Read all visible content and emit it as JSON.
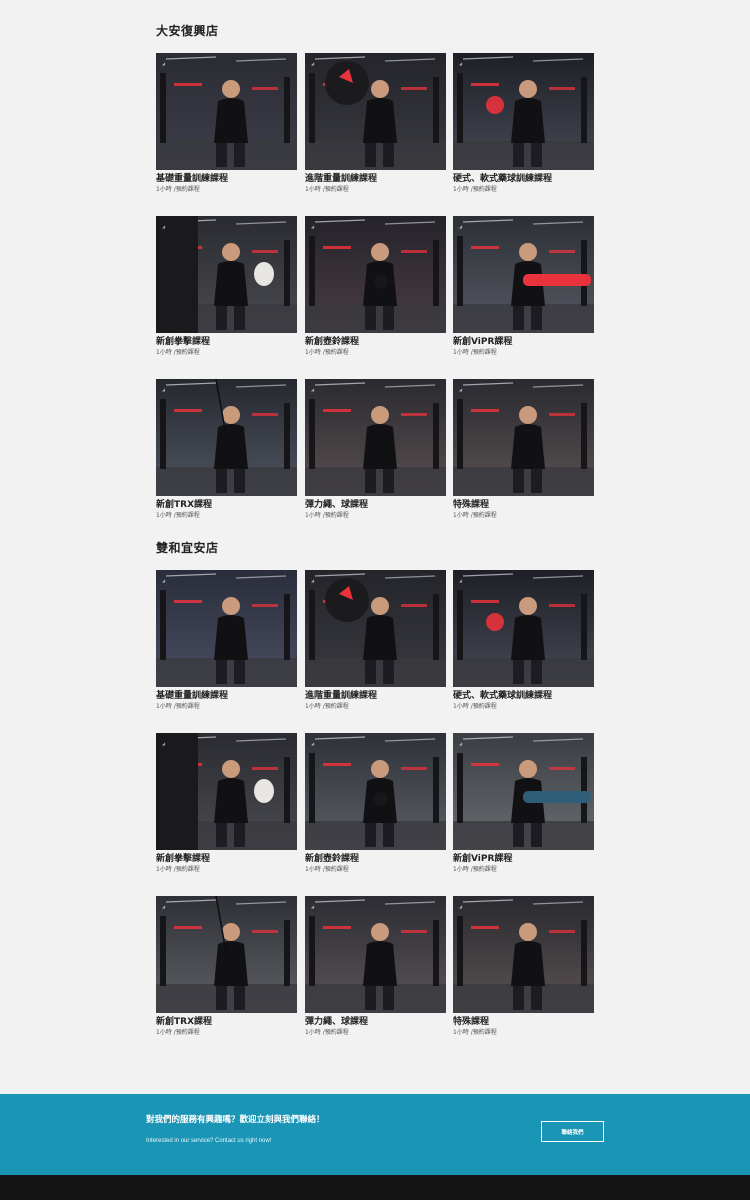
{
  "branches": [
    {
      "name": "大安復興店",
      "courses": [
        {
          "title": "基礎重量訓練課程",
          "meta": "1小時 /預約課程",
          "scene": "weights-overhead"
        },
        {
          "title": "進階重量訓練課程",
          "meta": "1小時 /預約課程",
          "scene": "bench-coach"
        },
        {
          "title": "硬式、軟式藥球訓練課程",
          "meta": "1小時 /預約課程",
          "scene": "medicine-ball"
        },
        {
          "title": "新創拳擊課程",
          "meta": "1小時 /預約課程",
          "scene": "boxing"
        },
        {
          "title": "新創壺鈴課程",
          "meta": "1小時 /預約課程",
          "scene": "kettlebell"
        },
        {
          "title": "新創ViPR課程",
          "meta": "1小時 /預約課程",
          "scene": "vipr"
        },
        {
          "title": "新創TRX課程",
          "meta": "1小時 /預約課程",
          "scene": "trx"
        },
        {
          "title": "彈力繩、球課程",
          "meta": "1小時 /預約課程",
          "scene": "band-stretch"
        },
        {
          "title": "特殊課程",
          "meta": "1小時 /預約課程",
          "scene": "special"
        }
      ]
    },
    {
      "name": "雙和宜安店",
      "courses": [
        {
          "title": "基礎重量訓練課程",
          "meta": "1小時 /預約課程",
          "scene": "chest-press"
        },
        {
          "title": "進階重量訓練課程",
          "meta": "1小時 /預約課程",
          "scene": "bench-coach"
        },
        {
          "title": "硬式、軟式藥球訓練課程",
          "meta": "1小時 /預約課程",
          "scene": "medicine-ball"
        },
        {
          "title": "新創拳擊課程",
          "meta": "1小時 /預約課程",
          "scene": "boxing"
        },
        {
          "title": "新創壺鈴課程",
          "meta": "1小時 /預約課程",
          "scene": "kettlebell-2"
        },
        {
          "title": "新創ViPR課程",
          "meta": "1小時 /預約課程",
          "scene": "vipr-2"
        },
        {
          "title": "新創TRX課程",
          "meta": "1小時 /預約課程",
          "scene": "trx-2"
        },
        {
          "title": "彈力繩、球課程",
          "meta": "1小時 /預約課程",
          "scene": "band-2"
        },
        {
          "title": "特殊課程",
          "meta": "1小時 /預約課程",
          "scene": "special"
        }
      ]
    }
  ],
  "cta": {
    "title": "對我們的服務有興趣嗎？歡迎立刻與我們聯絡！",
    "subtitle": "Interested in our service? Contact us right now!",
    "button_label": "聯絡我們"
  },
  "colors": {
    "page_bg": "#f2f2f2",
    "cta_bg": "#1b95b5",
    "footer_bg": "#141414",
    "accent_red": "#e8323c"
  }
}
